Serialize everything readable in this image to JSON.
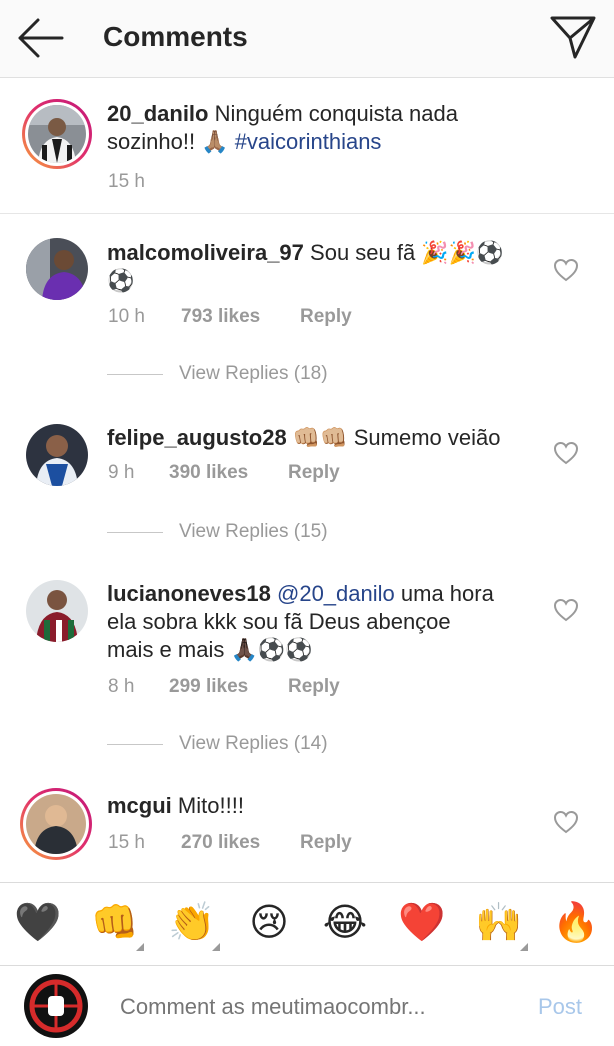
{
  "header": {
    "title": "Comments",
    "back_icon": "arrow-left-icon",
    "direct_icon": "paper-plane-icon"
  },
  "caption": {
    "username": "20_danilo",
    "text_line1": "Ninguém conquista nada",
    "text_line2": "sozinho!! 🙏🏽",
    "hashtag": "#vaicorinthians",
    "time": "15 h"
  },
  "comments": [
    {
      "username": "malcomoliveira_97",
      "text_line1": "Sou seu fã 🎉🎉⚽",
      "text_line2": "⚽",
      "time": "10 h",
      "likes": "793 likes",
      "reply": "Reply",
      "view_replies": "View Replies (18)"
    },
    {
      "username": "felipe_augusto28",
      "text_line1": "👊🏼👊🏼 Sumemo veião",
      "time": "9 h",
      "likes": "390 likes",
      "reply": "Reply",
      "view_replies": "View Replies (15)"
    },
    {
      "username": "lucianoneves18",
      "mention": "@20_danilo",
      "text_line1": "uma hora",
      "text_line2": "ela sobra kkk sou fã Deus abençoe",
      "text_line3": "mais e mais 🙏🏿⚽⚽",
      "time": "8 h",
      "likes": "299 likes",
      "reply": "Reply",
      "view_replies": "View Replies (14)"
    },
    {
      "username": "mcgui",
      "text_line1": "Mito!!!!",
      "time": "15 h",
      "likes": "270 likes",
      "reply": "Reply"
    }
  ],
  "emoji_bar": [
    "🖤",
    "👊",
    "👏",
    "😢",
    "😂",
    "❤️",
    "🙌",
    "🔥"
  ],
  "compose": {
    "placeholder": "Comment as meutimaocombr...",
    "post_label": "Post"
  },
  "colors": {
    "hashtag": "#27458a",
    "meta": "#999999",
    "post_disabled": "#a8c7ea",
    "story_ring_start": "#f9a53a",
    "story_ring_end": "#c1167a"
  }
}
